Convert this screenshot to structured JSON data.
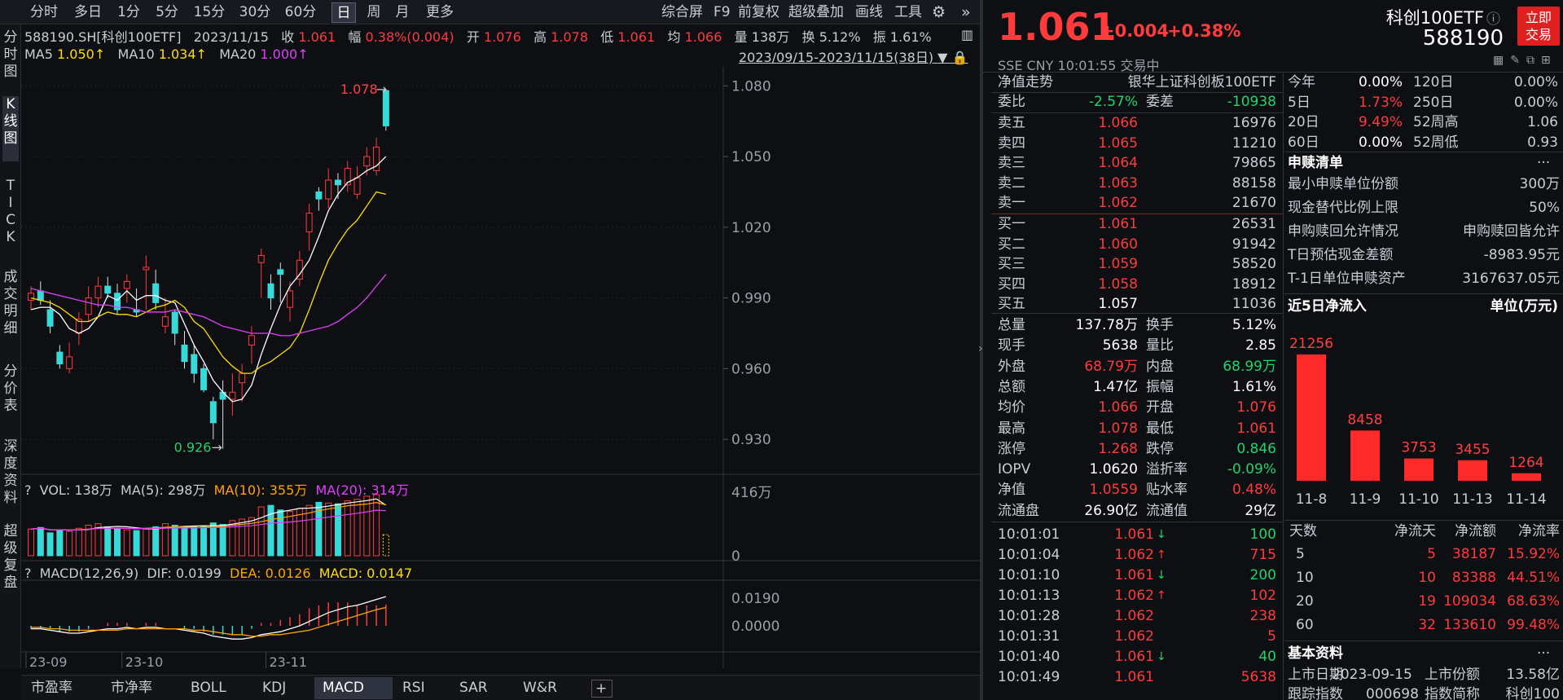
{
  "toolbar": {
    "periods": [
      "分时",
      "多日",
      "1分",
      "5分",
      "15分",
      "30分",
      "60分",
      "日",
      "周",
      "月",
      "更多"
    ],
    "right": [
      "综合屏",
      "F9",
      "前复权",
      "超级叠加",
      "画线",
      "工具"
    ]
  },
  "vtabs": [
    "分时图",
    "K线图",
    "TICK",
    "成交明细",
    "分价表",
    "深度资料",
    "超级复盘"
  ],
  "quote_line": {
    "code": "588190.SH[科创100ETF]",
    "date": "2023/11/15",
    "close_l": "收",
    "close": "1.061",
    "amp_l": "幅",
    "amp": "0.38%(0.004)",
    "open_l": "开",
    "open": "1.076",
    "high_l": "高",
    "high": "1.078",
    "low_l": "低",
    "low": "1.061",
    "avg_l": "均",
    "avg": "1.066",
    "vol_l": "量",
    "vol": "138万",
    "turn_l": "换",
    "turn": "5.12%",
    "sw_l": "振",
    "sw": "1.61%"
  },
  "ma_line": {
    "ma5_l": "MA5",
    "ma5": "1.050↑",
    "ma10_l": "MA10",
    "ma10": "1.034↑",
    "ma20_l": "MA20",
    "ma20": "1.000↑",
    "range": "2023/09/15-2023/11/15(38日)"
  },
  "vol_line": {
    "q": "?",
    "vol": "VOL: 138万",
    "ma5": "MA(5): 298万",
    "ma10": "MA(10): 355万",
    "ma20": "MA(20): 314万"
  },
  "macd_line": {
    "q": "?",
    "name": "MACD(12,26,9)",
    "dif": "DIF: 0.0199",
    "dea": "DEA: 0.0126",
    "macd": "MACD: 0.0147"
  },
  "bottom_tabs": [
    "市盈率",
    "市净率",
    "BOLL",
    "KDJ",
    "MACD",
    "RSI",
    "SAR",
    "W&R"
  ],
  "colors": {
    "up": "#ff3b3b",
    "down": "#23d36b",
    "candle_down": "#38d9d9",
    "ma5": "#ffffff",
    "ma10": "#ffde00",
    "ma20": "#e040fb"
  },
  "chart_data": {
    "type": "candlestick",
    "dates": [
      "09-15",
      "09-18",
      "09-19",
      "09-20",
      "09-21",
      "09-22",
      "09-25",
      "09-26",
      "09-27",
      "09-28",
      "10-09",
      "10-10",
      "10-11",
      "10-12",
      "10-13",
      "10-16",
      "10-17",
      "10-18",
      "10-19",
      "10-20",
      "10-23",
      "10-24",
      "10-25",
      "10-26",
      "10-27",
      "10-30",
      "10-31",
      "11-01",
      "11-02",
      "11-03",
      "11-06",
      "11-07",
      "11-08",
      "11-09",
      "11-10",
      "11-13",
      "11-14",
      "11-15"
    ],
    "open": [
      0.989,
      0.993,
      0.985,
      0.967,
      0.96,
      0.975,
      0.983,
      0.99,
      0.995,
      0.992,
      0.994,
      0.985,
      1.002,
      0.996,
      0.978,
      0.984,
      0.97,
      0.966,
      0.96,
      0.946,
      0.95,
      0.947,
      0.954,
      0.97,
      1.005,
      0.996,
      1.002,
      0.986,
      0.998,
      1.018,
      1.035,
      1.032,
      1.04,
      1.038,
      1.034,
      1.046,
      1.044,
      1.078
    ],
    "close": [
      0.992,
      0.989,
      0.978,
      0.962,
      0.965,
      0.981,
      0.99,
      0.995,
      0.992,
      0.985,
      0.997,
      0.984,
      1.003,
      0.988,
      0.982,
      0.975,
      0.963,
      0.958,
      0.951,
      0.937,
      0.947,
      0.95,
      0.958,
      0.974,
      1.008,
      0.99,
      1.0,
      0.993,
      1.006,
      1.026,
      1.032,
      1.04,
      1.038,
      1.045,
      1.041,
      1.05,
      1.054,
      1.063
    ],
    "high": [
      0.995,
      0.997,
      0.989,
      0.97,
      0.971,
      0.984,
      0.995,
      0.999,
      0.999,
      0.996,
      1.0,
      0.994,
      1.008,
      1.002,
      0.99,
      0.985,
      0.976,
      0.97,
      0.962,
      0.948,
      0.955,
      0.958,
      0.962,
      0.978,
      1.011,
      1.0,
      1.005,
      0.997,
      1.01,
      1.03,
      1.037,
      1.045,
      1.043,
      1.048,
      1.046,
      1.054,
      1.058,
      1.078
    ],
    "low": [
      0.985,
      0.987,
      0.975,
      0.96,
      0.958,
      0.97,
      0.98,
      0.986,
      0.99,
      0.983,
      0.988,
      0.982,
      0.985,
      0.985,
      0.975,
      0.97,
      0.96,
      0.954,
      0.95,
      0.93,
      0.926,
      0.94,
      0.946,
      0.962,
      0.99,
      0.985,
      0.988,
      0.98,
      0.995,
      1.01,
      1.027,
      1.028,
      1.032,
      1.035,
      1.032,
      1.042,
      1.042,
      1.061
    ],
    "volume": [
      175,
      185,
      150,
      170,
      160,
      180,
      200,
      210,
      190,
      180,
      170,
      165,
      175,
      190,
      210,
      200,
      185,
      190,
      195,
      215,
      205,
      230,
      240,
      250,
      320,
      330,
      300,
      290,
      310,
      330,
      350,
      345,
      340,
      360,
      370,
      390,
      400,
      138
    ],
    "ma5": [
      0.985,
      0.986,
      0.986,
      0.983,
      0.977,
      0.975,
      0.977,
      0.982,
      0.991,
      0.989,
      0.993,
      0.989,
      0.991,
      0.991,
      0.989,
      0.988,
      0.979,
      0.97,
      0.963,
      0.955,
      0.95,
      0.946,
      0.947,
      0.953,
      0.966,
      0.977,
      0.987,
      0.995,
      1.0,
      1.006,
      1.016,
      1.027,
      1.034,
      1.039,
      1.041,
      1.044,
      1.046,
      1.05
    ],
    "ma10": [
      0.99,
      0.989,
      0.988,
      0.986,
      0.983,
      0.98,
      0.98,
      0.982,
      0.984,
      0.983,
      0.983,
      0.982,
      0.984,
      0.986,
      0.987,
      0.989,
      0.986,
      0.98,
      0.977,
      0.971,
      0.965,
      0.961,
      0.958,
      0.958,
      0.961,
      0.963,
      0.966,
      0.969,
      0.975,
      0.985,
      0.996,
      1.006,
      1.013,
      1.019,
      1.023,
      1.029,
      1.035,
      1.034
    ],
    "ma20": [
      0.994,
      0.993,
      0.992,
      0.991,
      0.99,
      0.989,
      0.988,
      0.987,
      0.987,
      0.986,
      0.986,
      0.985,
      0.984,
      0.984,
      0.984,
      0.985,
      0.984,
      0.983,
      0.982,
      0.98,
      0.978,
      0.977,
      0.976,
      0.975,
      0.975,
      0.975,
      0.974,
      0.974,
      0.975,
      0.976,
      0.977,
      0.978,
      0.98,
      0.983,
      0.986,
      0.99,
      0.995,
      1.0
    ],
    "dif": [
      -0.002,
      -0.002,
      -0.003,
      -0.004,
      -0.005,
      -0.005,
      -0.004,
      -0.003,
      -0.002,
      -0.002,
      -0.001,
      -0.002,
      -0.001,
      -0.001,
      -0.002,
      -0.002,
      -0.003,
      -0.004,
      -0.005,
      -0.007,
      -0.008,
      -0.009,
      -0.009,
      -0.008,
      -0.006,
      -0.005,
      -0.004,
      -0.002,
      0.0,
      0.003,
      0.006,
      0.009,
      0.011,
      0.013,
      0.014,
      0.016,
      0.018,
      0.0199
    ],
    "dea": [
      -0.001,
      -0.001,
      -0.002,
      -0.002,
      -0.003,
      -0.003,
      -0.003,
      -0.003,
      -0.003,
      -0.003,
      -0.002,
      -0.002,
      -0.002,
      -0.002,
      -0.002,
      -0.002,
      -0.002,
      -0.003,
      -0.003,
      -0.004,
      -0.005,
      -0.006,
      -0.006,
      -0.007,
      -0.007,
      -0.006,
      -0.006,
      -0.005,
      -0.004,
      -0.003,
      -0.001,
      0.001,
      0.003,
      0.005,
      0.007,
      0.009,
      0.011,
      0.0126
    ],
    "price_ticks": [
      "1.080",
      "1.050",
      "1.020",
      "0.990",
      "0.960",
      "0.930"
    ],
    "price_tick_values": [
      1.08,
      1.05,
      1.02,
      0.99,
      0.96,
      0.93
    ],
    "vol_ticks": [
      "416万",
      "0"
    ],
    "macd_ticks": [
      "0.0190",
      "0.0000"
    ],
    "x_labels": [
      "23-09",
      "23-10",
      "23-11"
    ],
    "x_label_index": [
      0,
      10,
      25
    ],
    "high_mark": "1.078",
    "low_mark": "0.926",
    "ylim": [
      0.92,
      1.086
    ]
  },
  "right": {
    "price": "1.061",
    "change": "+0.004",
    "pct": "+0.38%",
    "name": "科创100ETF",
    "code": "588190",
    "buy_btn": [
      "立即",
      "交易"
    ],
    "sse": "SSE  CNY  10:01:55  交易中",
    "nav_trend": "净值走势",
    "index_name": "银华上证科创板100ETF",
    "wb_l": "委比",
    "wb": "-2.57%",
    "wc_l": "委差",
    "wc": "-10938",
    "asks": [
      {
        "l": "卖五",
        "p": "1.066",
        "v": "16976"
      },
      {
        "l": "卖四",
        "p": "1.065",
        "v": "11210"
      },
      {
        "l": "卖三",
        "p": "1.064",
        "v": "79865"
      },
      {
        "l": "卖二",
        "p": "1.063",
        "v": "88158"
      },
      {
        "l": "卖一",
        "p": "1.062",
        "v": "21670"
      }
    ],
    "bids": [
      {
        "l": "买一",
        "p": "1.061",
        "v": "26531"
      },
      {
        "l": "买二",
        "p": "1.060",
        "v": "91942"
      },
      {
        "l": "买三",
        "p": "1.059",
        "v": "58520"
      },
      {
        "l": "买四",
        "p": "1.058",
        "v": "18912"
      },
      {
        "l": "买五",
        "p": "1.057",
        "v": "11036"
      }
    ],
    "stats": [
      [
        "总量",
        "137.78万",
        "换手",
        "5.12%"
      ],
      [
        "现手",
        "5638",
        "量比",
        "2.85"
      ],
      [
        "外盘",
        "68.79万",
        "内盘",
        "68.99万"
      ],
      [
        "总额",
        "1.47亿",
        "振幅",
        "1.61%"
      ],
      [
        "均价",
        "1.066",
        "开盘",
        "1.076"
      ],
      [
        "最高",
        "1.078",
        "最低",
        "1.061"
      ],
      [
        "涨停",
        "1.268",
        "跌停",
        "0.846"
      ],
      [
        "IOPV",
        "1.0620",
        "溢折率",
        "-0.09%"
      ],
      [
        "净值",
        "1.0559",
        "贴水率",
        "0.48%"
      ],
      [
        "流通盘",
        "26.90亿",
        "流通值",
        "29亿"
      ]
    ],
    "ticks": [
      {
        "t": "10:01:01",
        "p": "1.061",
        "d": "↓",
        "v": "100"
      },
      {
        "t": "10:01:04",
        "p": "1.062",
        "d": "↑",
        "v": "715"
      },
      {
        "t": "10:01:10",
        "p": "1.061",
        "d": "↓",
        "v": "200"
      },
      {
        "t": "10:01:13",
        "p": "1.062",
        "d": "↑",
        "v": "102"
      },
      {
        "t": "10:01:28",
        "p": "1.062",
        "d": "",
        "v": "238"
      },
      {
        "t": "10:01:31",
        "p": "1.062",
        "d": "",
        "v": "5"
      },
      {
        "t": "10:01:40",
        "p": "1.061",
        "d": "↓",
        "v": "40"
      },
      {
        "t": "10:01:49",
        "p": "1.061",
        "d": "",
        "v": "5638"
      }
    ],
    "perf": [
      [
        "今年",
        "0.00%",
        "120日",
        "0.00%"
      ],
      [
        "5日",
        "1.73%",
        "250日",
        "0.00%"
      ],
      [
        "20日",
        "9.49%",
        "52周高",
        "1.06"
      ],
      [
        "60日",
        "0.00%",
        "52周低",
        "0.93"
      ]
    ],
    "sg_title": "申赎清单",
    "sg_more": "···",
    "sg": [
      [
        "最小申赎单位份额",
        "300万"
      ],
      [
        "现金替代比例上限",
        "50%"
      ],
      [
        "申购赎回允许情况",
        "申购赎回皆允许"
      ],
      [
        "T日预估现金差额",
        "-8983.95元"
      ],
      [
        "T-1日单位申赎资产",
        "3167637.05元"
      ]
    ],
    "flow_title": "近5日净流入",
    "flow_unit": "单位(万元)",
    "flow": {
      "labels": [
        "11-8",
        "11-9",
        "11-10",
        "11-13",
        "11-14"
      ],
      "values": [
        21256,
        8458,
        3753,
        3455,
        1264
      ],
      "texts": [
        "21256",
        "8458",
        "3753",
        "3455",
        "1264"
      ]
    },
    "ft_head": [
      "天数",
      "净流天",
      "净流额",
      "净流率"
    ],
    "ft": [
      [
        "5",
        "5",
        "38187",
        "15.92%"
      ],
      [
        "10",
        "10",
        "83388",
        "44.51%"
      ],
      [
        "20",
        "19",
        "109034",
        "68.63%"
      ],
      [
        "60",
        "32",
        "133610",
        "99.48%"
      ]
    ],
    "basic_title": "基本资料",
    "basic_more": "···",
    "basic": [
      "上市日期",
      "2023-09-15",
      "上市份额",
      "13.58亿"
    ],
    "basic2": [
      "跟踪指数",
      "000698",
      "指数简称",
      "科创100"
    ]
  }
}
